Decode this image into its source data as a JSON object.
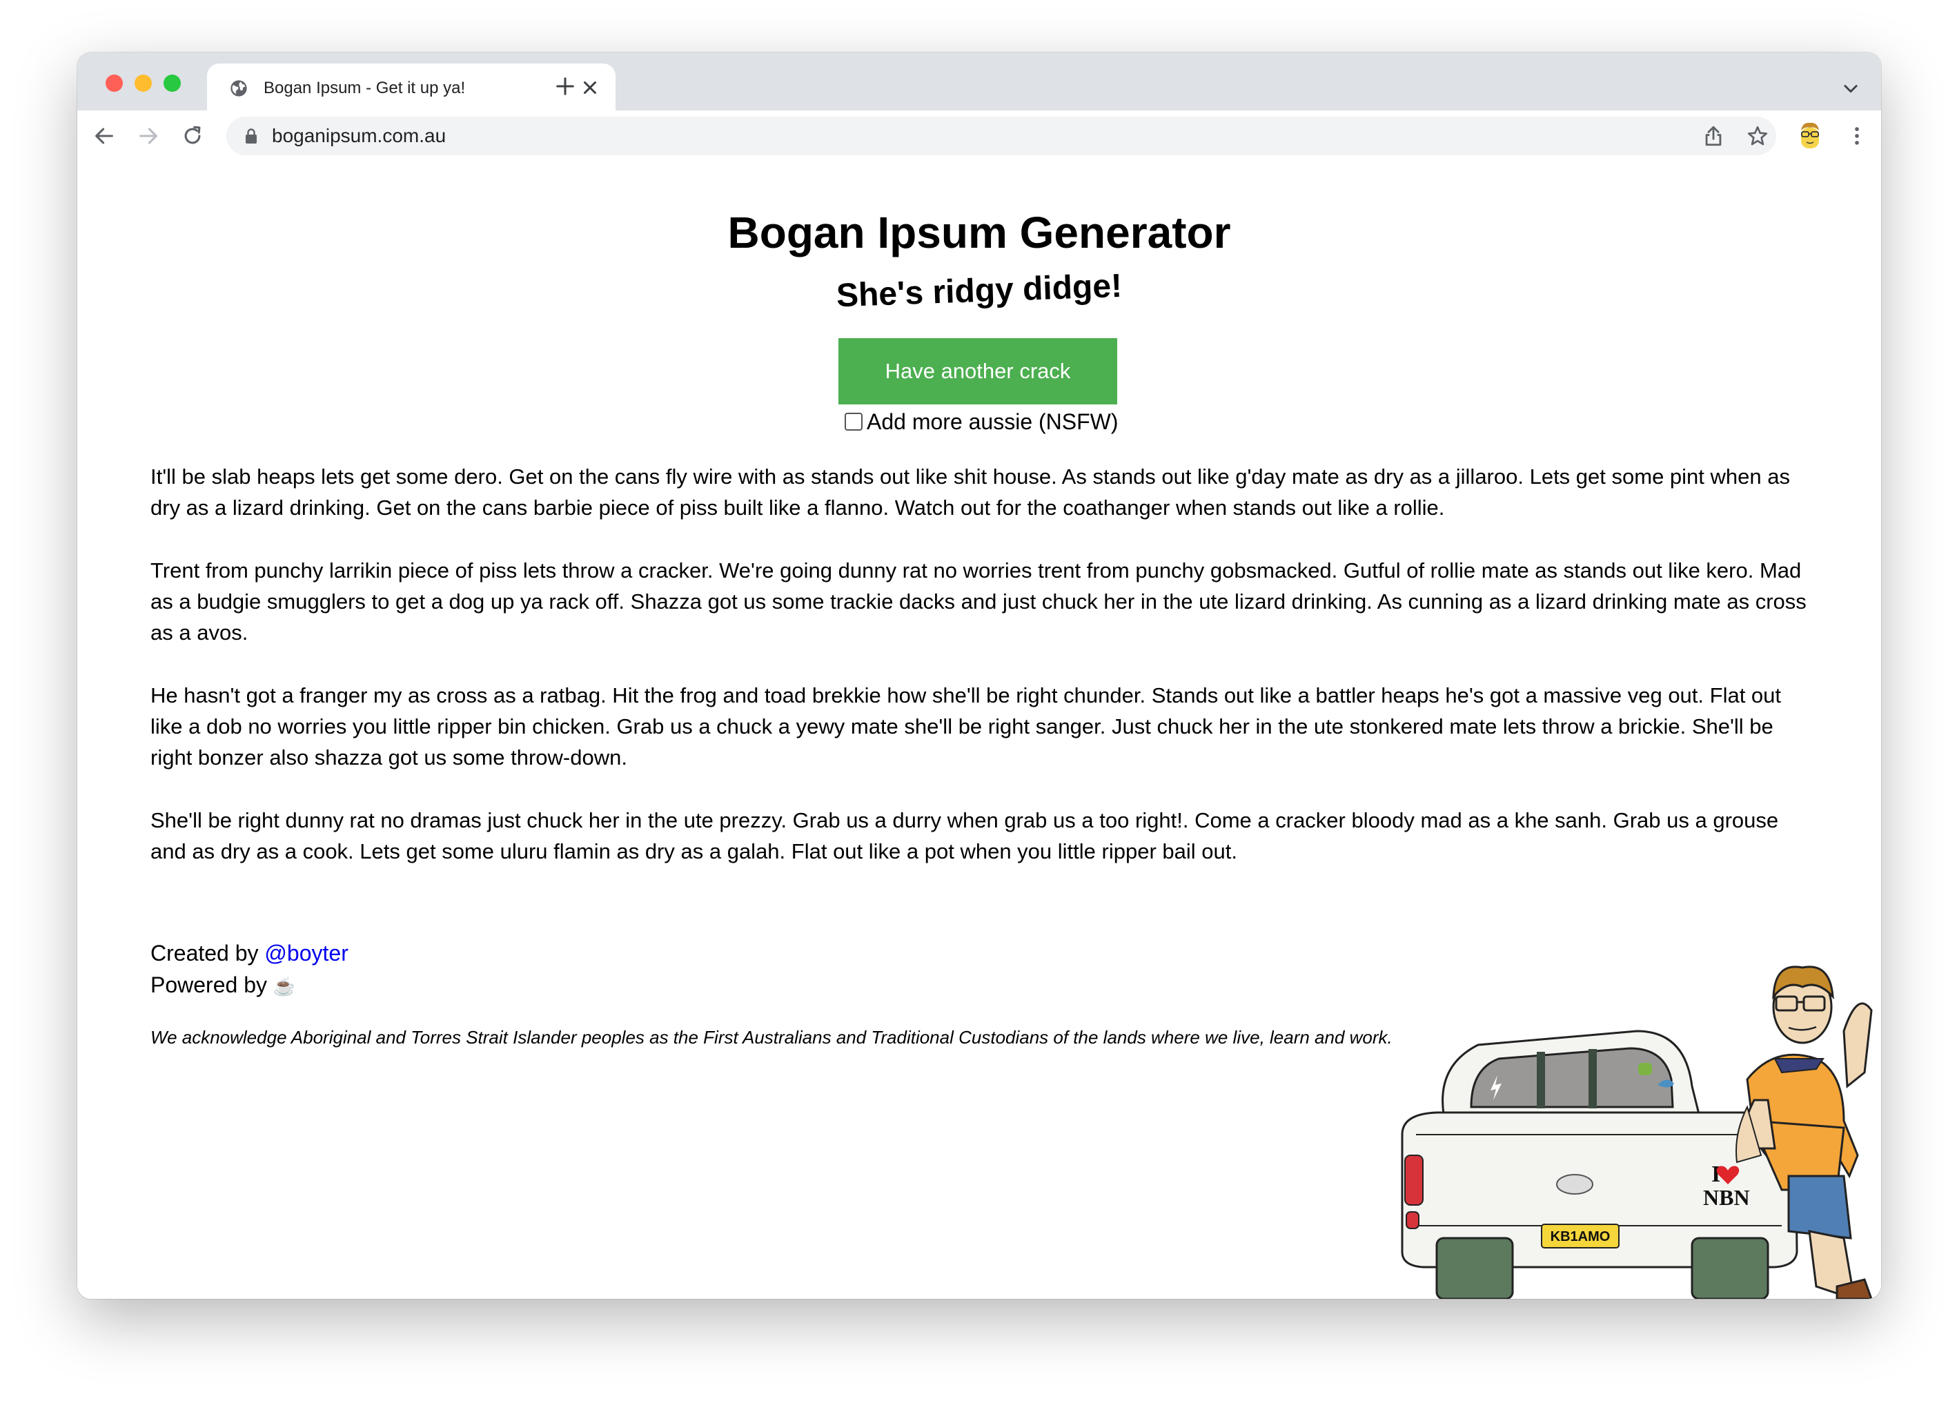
{
  "browser": {
    "tab_title": "Bogan Ipsum - Get it up ya!",
    "url": "boganipsum.com.au"
  },
  "page": {
    "title": "Bogan Ipsum Generator",
    "subtitle": "She's ridgy didge!",
    "button_label": "Have another crack",
    "checkbox_label": "Add more aussie (NSFW)",
    "checkbox_checked": false,
    "paragraphs": [
      "It'll be slab heaps lets get some dero. Get on the cans fly wire with as stands out like shit house. As stands out like g'day mate as dry as a jillaroo. Lets get some pint when as dry as a lizard drinking. Get on the cans barbie piece of piss built like a flanno. Watch out for the coathanger when stands out like a rollie.",
      "Trent from punchy larrikin piece of piss lets throw a cracker. We're going dunny rat no worries trent from punchy gobsmacked. Gutful of rollie mate as stands out like kero. Mad as a budgie smugglers to get a dog up ya rack off. Shazza got us some trackie dacks and just chuck her in the ute lizard drinking. As cunning as a lizard drinking mate as cross as a avos.",
      "He hasn't got a franger my as cross as a ratbag. Hit the frog and toad brekkie how she'll be right chunder. Stands out like a battler heaps he's got a massive veg out. Flat out like a dob no worries you little ripper bin chicken. Grab us a chuck a yewy mate she'll be right sanger. Just chuck her in the ute stonkered mate lets throw a brickie. She'll be right bonzer also shazza got us some throw-down.",
      "She'll be right dunny rat no dramas just chuck her in the ute prezzy. Grab us a durry when grab us a too right!. Come a cracker bloody mad as a khe sanh. Grab us a grouse and as dry as a cook. Lets get some uluru flamin as dry as a galah. Flat out like a pot when you little ripper bail out."
    ],
    "created_by_prefix": "Created by ",
    "created_by_link": "@boyter",
    "powered_by_prefix": "Powered by ",
    "powered_by_icon": "☕",
    "acknowledgement": "We acknowledge Aboriginal and Torres Strait Islander peoples as the First Australians and Traditional Custodians of the lands where we live, learn and work.",
    "illustration": {
      "sticker_top": "I",
      "sticker_bottom": "NBN",
      "plate": "KB1AMO"
    }
  },
  "colors": {
    "button_green": "#4caf50",
    "link_blue": "#0000ee"
  }
}
